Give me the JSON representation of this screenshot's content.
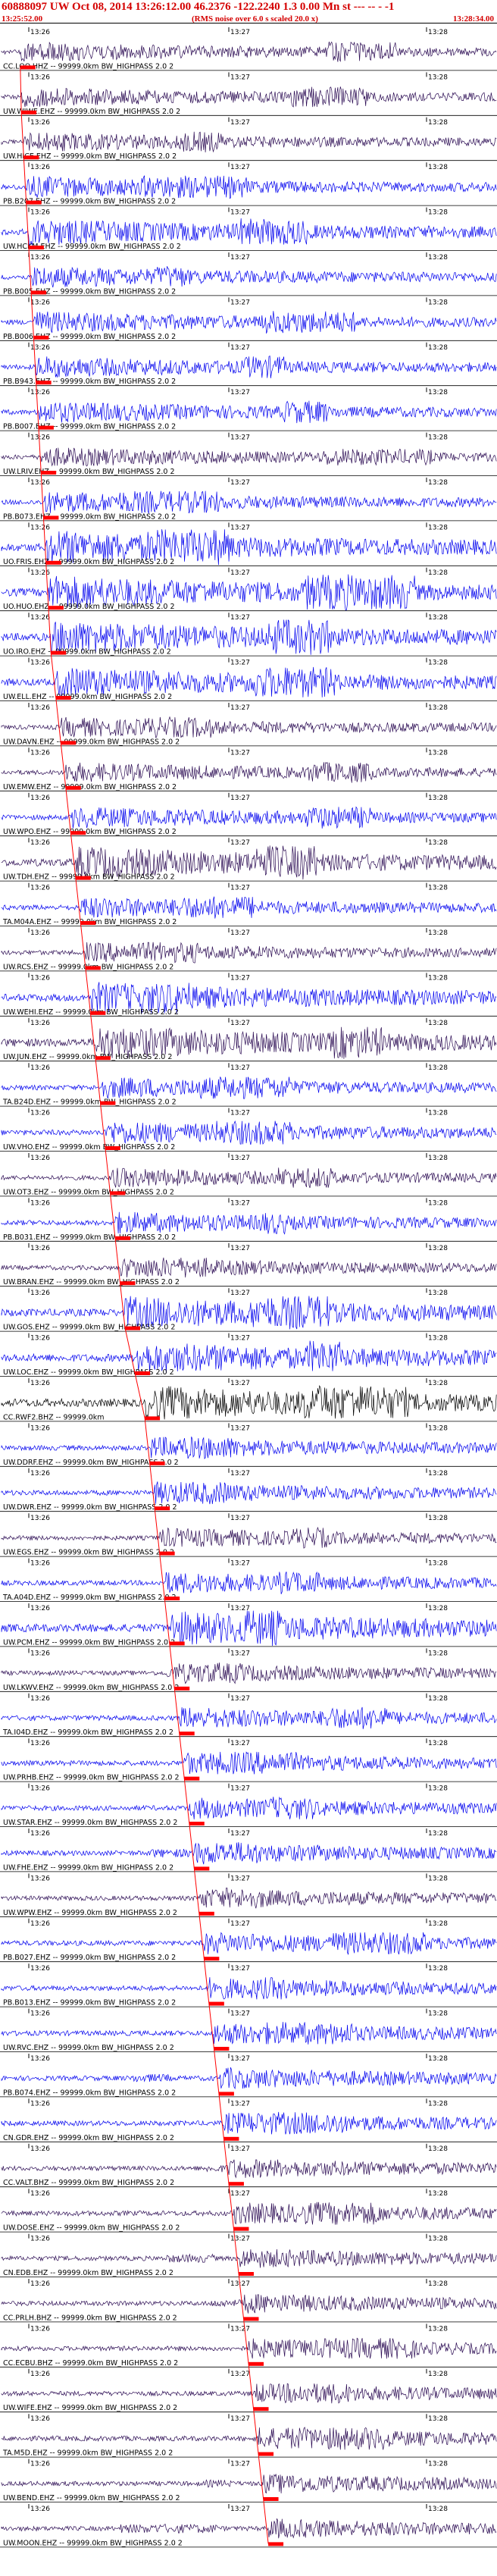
{
  "header": {
    "title": "60888097 UW Oct 08, 2014 13:26:12.00   46.2376 -122.2240   1.3 0.00 Mn st --- -- -   -1",
    "start_time": "13:25:52.00",
    "rms_note": "(RMS noise over 6.0 s scaled 20.0 x)",
    "end_time": "13:28:34.00"
  },
  "colors": {
    "header": "#d40000",
    "trace_dark": "#2a0a52",
    "trace_blue": "#0000ee",
    "trace_black": "#000000",
    "pick": "#ff0000",
    "tick": "#000000"
  },
  "chart_data": {
    "type": "line",
    "title": "60888097 UW Oct 08, 2014 13:26:12.00   46.2376 -122.2240   1.3 0.00 Mn st --- -- -   -1",
    "x_range": [
      "13:25:52.00",
      "13:28:34.00"
    ],
    "time_ticks": [
      "13:26",
      "13:27",
      "13:28"
    ],
    "traces": [
      {
        "label": "CC.LOO.HHZ -- 99999.0km BW_HIGHPASS  2.0  2",
        "pick_frac": 0.038,
        "amp": 0.55,
        "color": "dark"
      },
      {
        "label": "UW.WIWE.EHZ -- 99999.0km BW_HIGHPASS  2.0  2",
        "pick_frac": 0.04,
        "amp": 0.55,
        "color": "dark"
      },
      {
        "label": "UW.HICE.EHZ -- 99999.0km BW_HIGHPASS  2.0  2",
        "pick_frac": 0.045,
        "amp": 0.55,
        "color": "dark"
      },
      {
        "label": "PB.B207.EHZ -- 99999.0km BW_HIGHPASS  2.0  2",
        "pick_frac": 0.05,
        "amp": 0.6,
        "color": "blue"
      },
      {
        "label": "UW.HCKM.EHZ -- 99999.0km BW_HIGHPASS  2.0  2",
        "pick_frac": 0.055,
        "amp": 0.75,
        "color": "blue"
      },
      {
        "label": "PB.B005.EHZ -- 99999.0km BW_HIGHPASS  2.0  2",
        "pick_frac": 0.06,
        "amp": 0.6,
        "color": "blue"
      },
      {
        "label": "PB.B006.EHZ -- 99999.0km BW_HIGHPASS  2.0  2",
        "pick_frac": 0.065,
        "amp": 0.6,
        "color": "blue"
      },
      {
        "label": "PB.B943.EHZ -- 99999.0km BW_HIGHPASS  2.0  2",
        "pick_frac": 0.07,
        "amp": 0.6,
        "color": "blue"
      },
      {
        "label": "PB.B007.EHZ -- 99999.0km BW_HIGHPASS  2.0  2",
        "pick_frac": 0.075,
        "amp": 0.6,
        "color": "blue"
      },
      {
        "label": "UW.LRIV.EHZ -- 99999.0km BW_HIGHPASS  2.0  2",
        "pick_frac": 0.08,
        "amp": 0.55,
        "color": "dark"
      },
      {
        "label": "PB.B073.EHZ -- 99999.0km BW_HIGHPASS  2.0  2",
        "pick_frac": 0.085,
        "amp": 0.6,
        "color": "blue"
      },
      {
        "label": "UO.FRIS.EHZ -- 99999.0km BW_HIGHPASS  2.0  2",
        "pick_frac": 0.09,
        "amp": 0.95,
        "color": "blue"
      },
      {
        "label": "UO.HUO.EHZ -- 99999.0km BW_HIGHPASS  2.0  2",
        "pick_frac": 0.095,
        "amp": 0.95,
        "color": "blue"
      },
      {
        "label": "UO.IRO.EHZ -- 99999.0km BW_HIGHPASS  2.0  2",
        "pick_frac": 0.1,
        "amp": 0.95,
        "color": "blue"
      },
      {
        "label": "UW.ELL.EHZ -- 99999.0km BW_HIGHPASS  2.0  2",
        "pick_frac": 0.11,
        "amp": 0.85,
        "color": "blue"
      },
      {
        "label": "UW.DAVN.EHZ -- 99999.0km BW_HIGHPASS  2.0  2",
        "pick_frac": 0.12,
        "amp": 0.55,
        "color": "dark"
      },
      {
        "label": "UW.EMW.EHZ -- 99999.0km BW_HIGHPASS  2.0  2",
        "pick_frac": 0.13,
        "amp": 0.55,
        "color": "dark"
      },
      {
        "label": "UW.WPO.EHZ -- 99999.0km BW_HIGHPASS  2.0  2",
        "pick_frac": 0.14,
        "amp": 0.6,
        "color": "blue"
      },
      {
        "label": "UW.TDH.EHZ -- 99999.0km BW_HIGHPASS  2.0  2",
        "pick_frac": 0.15,
        "amp": 0.9,
        "color": "dark"
      },
      {
        "label": "TA.M04A.EHZ -- 99999.0km BW_HIGHPASS  2.0  2",
        "pick_frac": 0.16,
        "amp": 0.6,
        "color": "blue"
      },
      {
        "label": "UW.RCS.EHZ -- 99999.0km BW_HIGHPASS  2.0  2",
        "pick_frac": 0.17,
        "amp": 0.55,
        "color": "dark"
      },
      {
        "label": "UW.WEHI.EHZ -- 99999.0km BW_HIGHPASS  2.0  2",
        "pick_frac": 0.18,
        "amp": 0.85,
        "color": "blue"
      },
      {
        "label": "UW.JUN.EHZ -- 99999.0km BW_HIGHPASS  2.0  2",
        "pick_frac": 0.19,
        "amp": 0.95,
        "color": "dark"
      },
      {
        "label": "TA.B24D.EHZ -- 99999.0km BW_HIGHPASS  2.0  2",
        "pick_frac": 0.2,
        "amp": 0.6,
        "color": "blue"
      },
      {
        "label": "UW.VHO.EHZ -- 99999.0km BW_HIGHPASS  2.0  2",
        "pick_frac": 0.21,
        "amp": 0.65,
        "color": "blue"
      },
      {
        "label": "UW.OT3.EHZ -- 99999.0km BW_HIGHPASS  2.0  2",
        "pick_frac": 0.22,
        "amp": 0.55,
        "color": "dark"
      },
      {
        "label": "PB.B031.EHZ -- 99999.0km BW_HIGHPASS  2.0  2",
        "pick_frac": 0.23,
        "amp": 0.6,
        "color": "blue"
      },
      {
        "label": "UW.BRAN.EHZ -- 99999.0km BW_HIGHPASS  2.0  2",
        "pick_frac": 0.24,
        "amp": 0.55,
        "color": "dark"
      },
      {
        "label": "UW.GOS.EHZ -- 99999.0km BW_HIGHPASS  2.0  2",
        "pick_frac": 0.25,
        "amp": 0.9,
        "color": "blue"
      },
      {
        "label": "UW.LOC.EHZ -- 99999.0km BW_HIGHPASS  2.0  2",
        "pick_frac": 0.27,
        "amp": 0.9,
        "color": "blue"
      },
      {
        "label": "CC.RWF2.BHZ -- 99999.0km",
        "pick_frac": 0.29,
        "amp": 0.95,
        "color": "black"
      },
      {
        "label": "UW.DDRF.EHZ -- 99999.0km BW_HIGHPASS  2.0  2",
        "pick_frac": 0.3,
        "amp": 0.6,
        "color": "blue"
      },
      {
        "label": "UW.DWR.EHZ -- 99999.0km BW_HIGHPASS  2.0  2",
        "pick_frac": 0.31,
        "amp": 0.6,
        "color": "blue"
      },
      {
        "label": "UW.EGS.EHZ -- 99999.0km BW_HIGHPASS  2.0  2",
        "pick_frac": 0.32,
        "amp": 0.55,
        "color": "dark"
      },
      {
        "label": "TA.A04D.EHZ -- 99999.0km BW_HIGHPASS  2.0  2",
        "pick_frac": 0.33,
        "amp": 0.6,
        "color": "blue"
      },
      {
        "label": "UW.PCM.EHZ -- 99999.0km BW_HIGHPASS  2.0  2",
        "pick_frac": 0.34,
        "amp": 0.95,
        "color": "blue"
      },
      {
        "label": "UW.LKWV.EHZ -- 99999.0km BW_HIGHPASS  2.0  2",
        "pick_frac": 0.35,
        "amp": 0.55,
        "color": "dark"
      },
      {
        "label": "TA.I04D.EHZ -- 99999.0km BW_HIGHPASS  2.0  2",
        "pick_frac": 0.36,
        "amp": 0.6,
        "color": "blue"
      },
      {
        "label": "UW.PRHB.EHZ -- 99999.0km BW_HIGHPASS  2.0  2",
        "pick_frac": 0.37,
        "amp": 0.6,
        "color": "blue"
      },
      {
        "label": "UW.STAR.EHZ -- 99999.0km BW_HIGHPASS  2.0  2",
        "pick_frac": 0.38,
        "amp": 0.6,
        "color": "blue"
      },
      {
        "label": "UW.FHE.EHZ -- 99999.0km BW_HIGHPASS  2.0  2",
        "pick_frac": 0.39,
        "amp": 0.6,
        "color": "blue"
      },
      {
        "label": "UW.WPW.EHZ -- 99999.0km BW_HIGHPASS  2.0  2",
        "pick_frac": 0.4,
        "amp": 0.55,
        "color": "dark"
      },
      {
        "label": "PB.B027.EHZ -- 99999.0km BW_HIGHPASS  2.0  2",
        "pick_frac": 0.41,
        "amp": 0.6,
        "color": "blue"
      },
      {
        "label": "PB.B013.EHZ -- 99999.0km BW_HIGHPASS  2.0  2",
        "pick_frac": 0.42,
        "amp": 0.6,
        "color": "blue"
      },
      {
        "label": "UW.RVC.EHZ -- 99999.0km BW_HIGHPASS  2.0  2",
        "pick_frac": 0.43,
        "amp": 0.6,
        "color": "blue"
      },
      {
        "label": "PB.B074.EHZ -- 99999.0km BW_HIGHPASS  2.0  2",
        "pick_frac": 0.44,
        "amp": 0.6,
        "color": "blue"
      },
      {
        "label": "CN.GDR.EHZ -- 99999.0km BW_HIGHPASS  2.0  2",
        "pick_frac": 0.45,
        "amp": 0.6,
        "color": "blue"
      },
      {
        "label": "CC.VALT.BHZ -- 99999.0km BW_HIGHPASS  2.0  2",
        "pick_frac": 0.46,
        "amp": 0.55,
        "color": "dark"
      },
      {
        "label": "UW.DOSE.EHZ -- 99999.0km BW_HIGHPASS  2.0  2",
        "pick_frac": 0.47,
        "amp": 0.6,
        "color": "dark"
      },
      {
        "label": "CN.EDB.EHZ -- 99999.0km BW_HIGHPASS  2.0  2",
        "pick_frac": 0.48,
        "amp": 0.55,
        "color": "dark"
      },
      {
        "label": "CC.PRLH.BHZ -- 99999.0km BW_HIGHPASS  2.0  2",
        "pick_frac": 0.49,
        "amp": 0.55,
        "color": "dark"
      },
      {
        "label": "CC.ECBU.BHZ -- 99999.0km BW_HIGHPASS  2.0  2",
        "pick_frac": 0.5,
        "amp": 0.55,
        "color": "dark"
      },
      {
        "label": "UW.WIFE.EHZ -- 99999.0km BW_HIGHPASS  2.0  2",
        "pick_frac": 0.51,
        "amp": 0.55,
        "color": "dark"
      },
      {
        "label": "TA.M5D.EHZ -- 99999.0km BW_HIGHPASS  2.0  2",
        "pick_frac": 0.52,
        "amp": 0.6,
        "color": "dark"
      },
      {
        "label": "UW.BEND.EHZ -- 99999.0km BW_HIGHPASS  2.0  2",
        "pick_frac": 0.53,
        "amp": 0.55,
        "color": "dark"
      },
      {
        "label": "UW.MOON.EHZ -- 99999.0km BW_HIGHPASS  2.0  2",
        "pick_frac": 0.54,
        "amp": 0.55,
        "color": "dark"
      }
    ]
  }
}
